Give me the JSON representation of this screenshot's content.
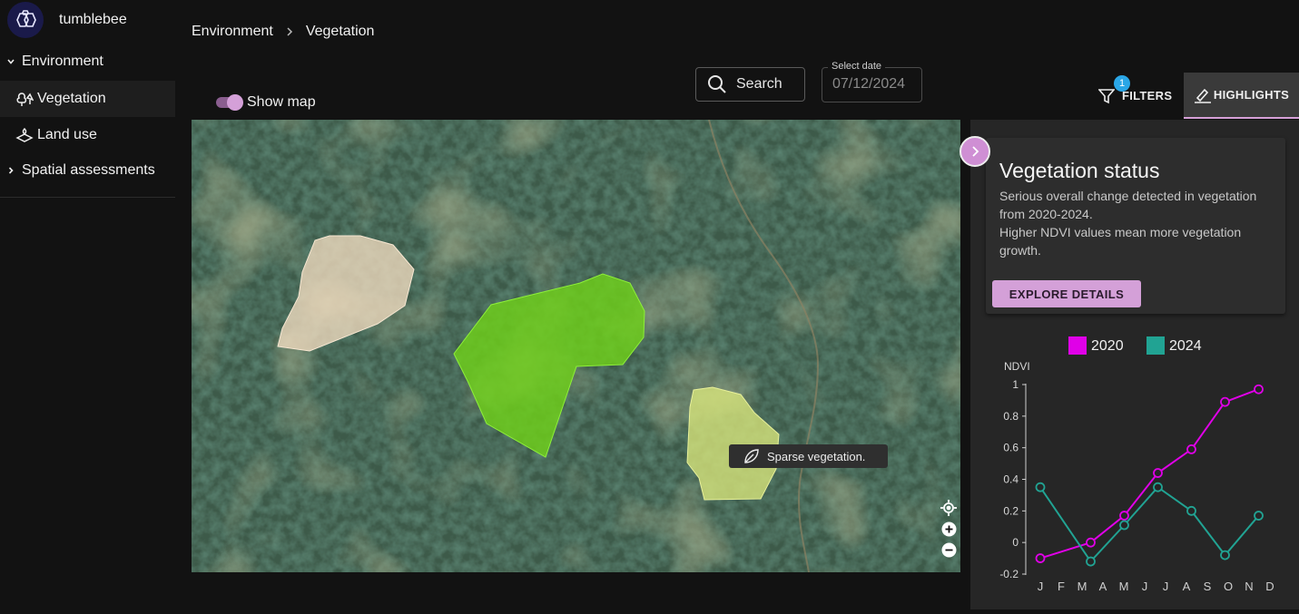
{
  "app": {
    "name": "tumblebee"
  },
  "sidebar": {
    "items": [
      {
        "label": "Environment",
        "expanded": true
      },
      {
        "label": "Vegetation",
        "active": true,
        "icon": "tree-icon"
      },
      {
        "label": "Land use",
        "icon": "land-use-icon"
      },
      {
        "label": "Spatial assessments",
        "expanded": false
      }
    ]
  },
  "breadcrumb": {
    "parent": "Environment",
    "current": "Vegetation"
  },
  "search": {
    "label": "Search"
  },
  "date": {
    "legend": "Select date",
    "value": "07/12/2024"
  },
  "map_toggle": {
    "label": "Show map",
    "on": true
  },
  "tabs": {
    "filters": {
      "label": "FILTERS",
      "badge": "1"
    },
    "highlights": {
      "label": "HIGHLIGHTS",
      "active": true
    }
  },
  "map": {
    "tooltip": "Sparse vegetation.",
    "zones": [
      {
        "name": "zone-beige",
        "color": "#f2dcc0"
      },
      {
        "name": "zone-green",
        "color": "#6fd11a"
      },
      {
        "name": "zone-yellow",
        "color": "#d6e37a"
      }
    ]
  },
  "highlight_card": {
    "title": "Vegetation status",
    "desc1": "Serious overall change detected in vegetation from 2020-2024.",
    "desc2": "Higher NDVI values mean more vegetation growth.",
    "button": "EXPLORE DETAILS"
  },
  "colors": {
    "accent": "#d4a0d8",
    "badge": "#2aa6e6",
    "series2020": "#e000e8",
    "series2024": "#21a393"
  },
  "chart_data": {
    "type": "line",
    "ylabel": "NDVI",
    "ylim": [
      -0.2,
      1
    ],
    "yticks": [
      "1",
      "0.8",
      "0.6",
      "0.4",
      "0.2",
      "0",
      "-0.2"
    ],
    "ytick_values": [
      1,
      0.8,
      0.6,
      0.4,
      0.2,
      0,
      -0.2
    ],
    "categories": [
      "J",
      "F",
      "M",
      "A",
      "M",
      "J",
      "J",
      "A",
      "S",
      "O",
      "N",
      "D"
    ],
    "series": [
      {
        "name": "2020",
        "color": "#e000e8",
        "points": [
          [
            0,
            -0.1
          ],
          [
            1.5,
            0.0
          ],
          [
            2.5,
            0.17
          ],
          [
            3.5,
            0.44
          ],
          [
            4.5,
            0.59
          ],
          [
            5.5,
            0.89
          ],
          [
            6.5,
            0.97
          ]
        ]
      },
      {
        "name": "2024",
        "color": "#21a393",
        "points": [
          [
            0,
            0.35
          ],
          [
            1.5,
            -0.12
          ],
          [
            2.5,
            0.11
          ],
          [
            3.5,
            0.35
          ],
          [
            4.5,
            0.2
          ],
          [
            5.5,
            -0.08
          ],
          [
            6.5,
            0.17
          ]
        ]
      }
    ],
    "legend": "top"
  }
}
